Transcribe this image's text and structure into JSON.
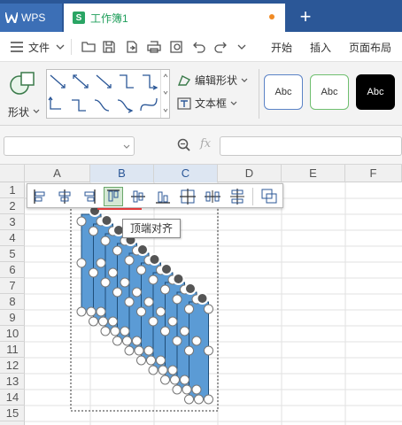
{
  "tabs": {
    "app_label": "WPS",
    "doc_label": "工作簿1",
    "new_tab": "+"
  },
  "menu": {
    "file_label": "文件",
    "items": [
      "开始",
      "插入",
      "页面布局"
    ]
  },
  "ribbon": {
    "shape_label": "形状",
    "edit_shape_label": "编辑形状",
    "textbox_label": "文本框",
    "style_cards": [
      "Abc",
      "Abc",
      "Abc"
    ]
  },
  "formula": {
    "fx": "fx"
  },
  "columns": [
    "A",
    "B",
    "C",
    "D",
    "E",
    "F"
  ],
  "rows": [
    "1",
    "2",
    "3",
    "4",
    "5",
    "6",
    "7",
    "8",
    "9",
    "10",
    "11",
    "12",
    "13",
    "14",
    "15"
  ],
  "align_toolbar": {
    "tooltip": "顶端对齐"
  },
  "colors": {
    "title_bar": "#2b5797",
    "shape_fill": "#5b9bd5",
    "shape_stroke": "#1f4e79",
    "doc_tab_accent": "#1e9e5a"
  },
  "icons": [
    "wps-logo-icon",
    "sheet-icon",
    "menu-hamburger-icon",
    "open-icon",
    "save-icon",
    "export-icon",
    "print-icon",
    "preview-icon",
    "undo-icon",
    "redo-icon",
    "zoom-icon",
    "align-left-icon",
    "align-center-icon",
    "align-right-icon",
    "align-top-icon",
    "align-middle-icon",
    "align-bottom-icon",
    "distribute-horizontal-icon",
    "distribute-h-space-icon",
    "distribute-v-space-icon",
    "group-icon"
  ]
}
